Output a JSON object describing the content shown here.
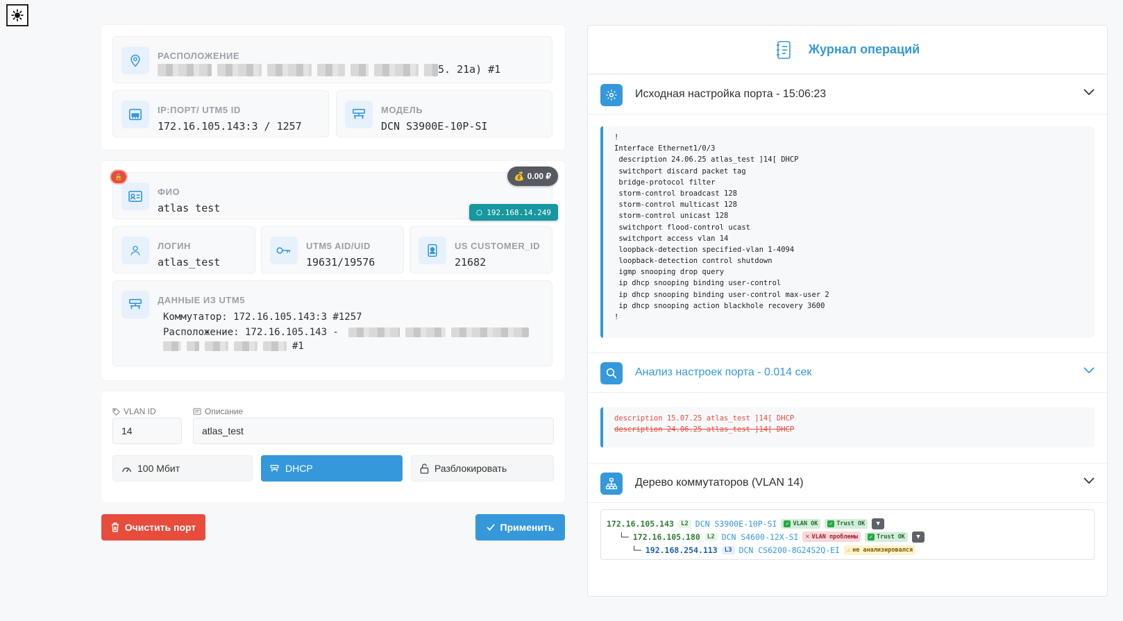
{
  "theme_icon": "sun-icon",
  "location": {
    "label": "РАСПОЛОЖЕНИЕ",
    "value_tail": "5. 21а) #1"
  },
  "ipport": {
    "label": "IP:ПОРТ/ UTM5 ID",
    "value": "172.16.105.143:3 / 1257"
  },
  "model": {
    "label": "МОДЕЛЬ",
    "value": "DCN S3900E-10P-SI"
  },
  "fio": {
    "label": "ФИО",
    "value": "atlas test"
  },
  "balance": {
    "icon": "💰",
    "value": "0.00 ₽"
  },
  "user_ip": "192.168.14.249",
  "login": {
    "label": "ЛОГИН",
    "value": "atlas_test"
  },
  "aid": {
    "label": "UTM5 AID/UID",
    "value": "19631/19576"
  },
  "customer": {
    "label": "US CUSTOMER_ID",
    "value": "21682"
  },
  "utm": {
    "label": "ДАННЫЕ ИЗ UTM5",
    "switch_line": "Коммутатор: 172.16.105.143:3 #1257",
    "location_prefix": "Расположение: 172.16.105.143 -",
    "location_tail": "#1"
  },
  "form": {
    "vlan_label": "VLAN ID",
    "vlan_value": "14",
    "desc_label": "Описание",
    "desc_value": "atlas_test",
    "speed_label": "100 Мбит",
    "dhcp_label": "DHCP",
    "unblock_label": "Разблокировать"
  },
  "actions": {
    "clear_label": "Очистить порт",
    "apply_label": "Применить"
  },
  "log": {
    "title": "Журнал операций",
    "initial": {
      "title": "Исходная настройка порта - 15:06:23",
      "lines": [
        "!",
        "Interface Ethernet1/0/3",
        " description 24.06.25 atlas_test ]14[ DHCP",
        " switchport discard packet tag",
        " bridge-protocol filter",
        " storm-control broadcast 128",
        " storm-control multicast 128",
        " storm-control unicast 128",
        " switchport flood-control ucast",
        " switchport access vlan 14",
        " loopback-detection specified-vlan 1-4094",
        " loopback-detection control shutdown",
        " igmp snooping drop query",
        " ip dhcp snooping binding user-control",
        " ip dhcp snooping binding user-control max-user 2",
        " ip dhcp snooping action blackhole recovery 3600",
        "!"
      ]
    },
    "analysis": {
      "title": "Анализ настроек порта - 0.014 сек",
      "added": "description 15.07.25 atlas_test ]14[ DHCP",
      "removed": "description 24.06.25 atlas_test ]14[ DHCP"
    },
    "tree": {
      "title": "Дерево коммутаторов (VLAN 14)",
      "rows": [
        {
          "prefix": "",
          "ip": "172.16.105.143",
          "level": "L2",
          "model": "DCN S3900E-10P-SI",
          "tags": [
            {
              "type": "ok",
              "text": "VLAN OK"
            },
            {
              "type": "ok",
              "text": "Trust OK"
            }
          ],
          "expand": "▼"
        },
        {
          "prefix": "└─",
          "ip": "172.16.105.180",
          "level": "L2",
          "model": "DCN S4600-12X-SI",
          "tags": [
            {
              "type": "bad",
              "text": "VLAN проблемы"
            },
            {
              "type": "ok",
              "text": "Trust OK"
            }
          ],
          "expand": "▼"
        },
        {
          "prefix": "└─",
          "ip": "192.168.254.113",
          "level": "L3",
          "model": "DCN CS6200-8G24S2Q-EI",
          "tags": [
            {
              "type": "warn",
              "text": "не анализировался"
            }
          ],
          "expand": ""
        }
      ]
    }
  }
}
